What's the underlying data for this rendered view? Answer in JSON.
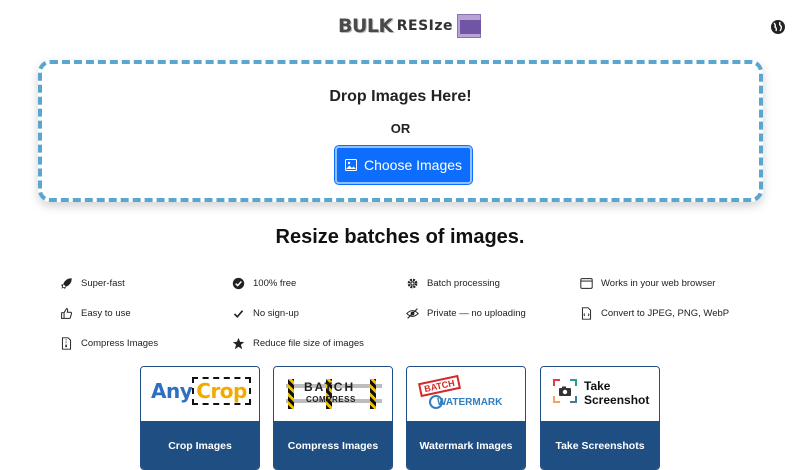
{
  "header": {
    "logo_bulk": "BULK",
    "logo_resize": "RESIze",
    "globe_icon": "globe-icon"
  },
  "dropzone": {
    "title": "Drop Images Here!",
    "or": "OR",
    "button_label": "Choose Images",
    "button_icon": "image-icon",
    "border_color": "#5aa6cf"
  },
  "headline": "Resize batches of images.",
  "features": [
    {
      "icon": "rocket-icon",
      "label": "Super-fast"
    },
    {
      "icon": "check-circle-icon",
      "label": "100% free"
    },
    {
      "icon": "gear-icon",
      "label": "Batch processing"
    },
    {
      "icon": "browser-window-icon",
      "label": "Works in your web browser"
    },
    {
      "icon": "thumbs-up-icon",
      "label": "Easy to use"
    },
    {
      "icon": "check-icon",
      "label": "No sign-up"
    },
    {
      "icon": "eye-slash-icon",
      "label": "Private — no uploading"
    },
    {
      "icon": "file-code-icon",
      "label": "Convert to JPEG, PNG, WebP"
    },
    {
      "icon": "file-zip-icon",
      "label": "Compress Images"
    },
    {
      "icon": "star-icon",
      "label": "Reduce file size of images"
    }
  ],
  "cards": [
    {
      "label": "Crop Images",
      "logo_any": "Any",
      "logo_crop": "Crop"
    },
    {
      "label": "Compress Images",
      "logo_batch": "BATCH",
      "logo_compress": "COMPRESS"
    },
    {
      "label": "Watermark Images",
      "logo_batch": "BATCH",
      "logo_watermark": "WATERMARK"
    },
    {
      "label": "Take Screenshots",
      "logo_line1": "Take",
      "logo_line2": "Screenshot"
    }
  ],
  "colors": {
    "accent": "#0d6efd",
    "card_bar": "#1f4f82"
  }
}
